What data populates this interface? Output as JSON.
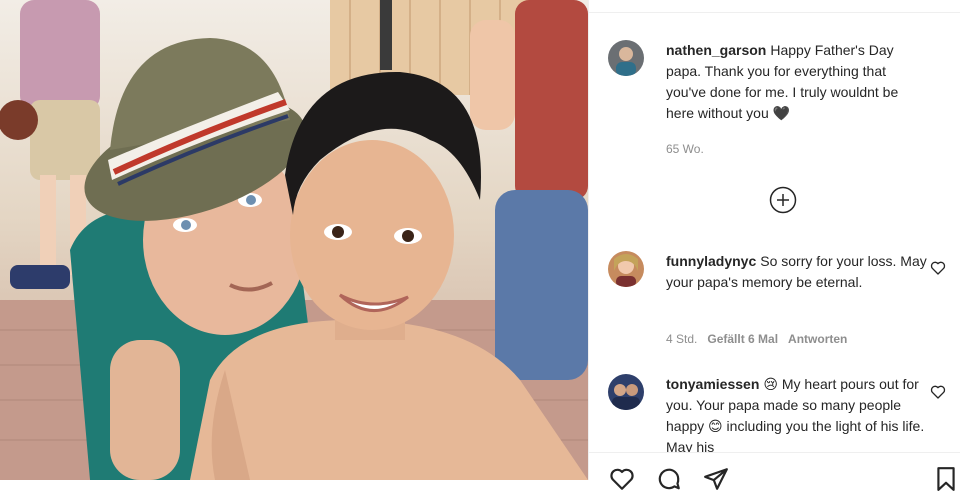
{
  "post": {
    "photo": "father-and-son-photo",
    "author": "nathen_garson",
    "caption": "Happy Father's Day papa. Thank you for everything that you've done for me. I truly wouldnt be here without you",
    "caption_emoji": "🖤",
    "time": "65 Wo."
  },
  "load_more_icon": "plus-circle-icon",
  "comments": [
    {
      "username": "funnyladynyc",
      "text": "So sorry for your loss. May your papa's memory be eternal.",
      "time": "4 Std.",
      "likes": "Gefällt 6 Mal",
      "reply": "Antworten"
    },
    {
      "username": "tonyamiessen",
      "emoji": "😢",
      "text_a": "My heart pours out for you. Your papa made so many people happy",
      "emoji2": "😊",
      "text_b": "including you the light of his life. May his"
    }
  ],
  "actions": [
    "heart-icon",
    "comment-icon",
    "share-icon",
    "bookmark-icon"
  ],
  "colors": {
    "text": "#262626",
    "secondary": "#8e8e8e",
    "divider": "#efefef"
  }
}
